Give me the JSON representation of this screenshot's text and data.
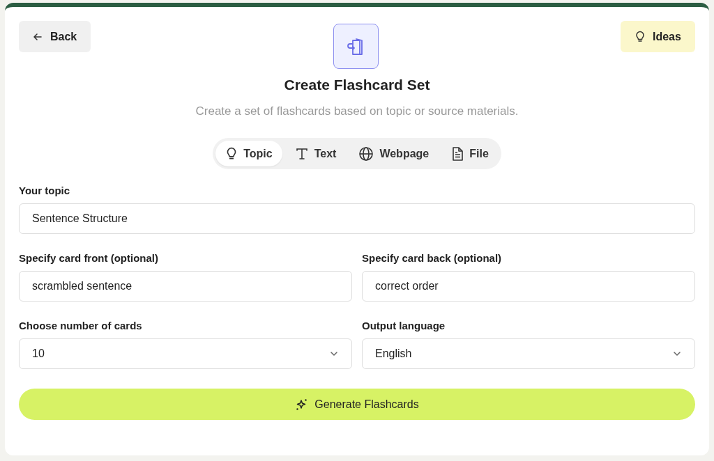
{
  "back_button": {
    "label": "Back"
  },
  "ideas_button": {
    "label": "Ideas"
  },
  "title": "Create Flashcard Set",
  "subtitle": "Create a set of flashcards based on topic or source materials.",
  "tabs": [
    {
      "label": "Topic",
      "kind": "topic",
      "selected": true
    },
    {
      "label": "Text",
      "kind": "text",
      "selected": false
    },
    {
      "label": "Webpage",
      "kind": "webpage",
      "selected": false
    },
    {
      "label": "File",
      "kind": "file",
      "selected": false
    }
  ],
  "topic_field": {
    "label": "Your topic",
    "value": "Sentence Structure"
  },
  "fields": [
    {
      "label": "Specify card front (optional)",
      "kind": "text",
      "value": "scrambled sentence"
    },
    {
      "label": "Specify card back (optional)",
      "kind": "text",
      "value": "correct order"
    },
    {
      "label": "Choose number of cards",
      "kind": "select",
      "value": "10"
    },
    {
      "label": "Output language",
      "kind": "select",
      "value": "English"
    }
  ],
  "generate_button": {
    "label": "Generate Flashcards"
  }
}
